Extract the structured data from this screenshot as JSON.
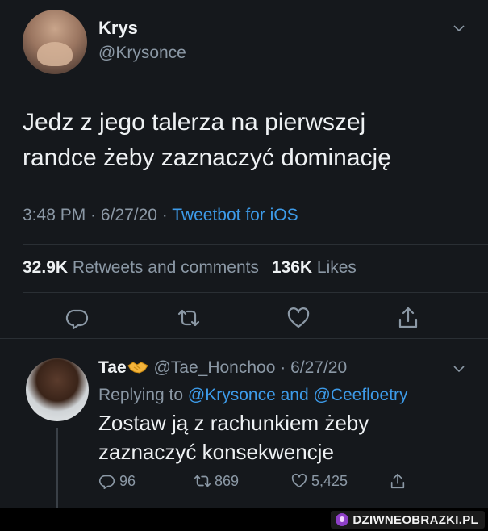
{
  "tweet": {
    "author_name": "Krys",
    "author_handle": "@Krysonce",
    "text_line1": "Jedz z jego talerza na pierwszej",
    "text_line2": "randce żeby zaznaczyć dominację",
    "time": "3:48 PM",
    "date": "6/27/20",
    "separator": " · ",
    "client": "Tweetbot for iOS",
    "retweets_count": "32.9K",
    "retweets_label": "Retweets and comments",
    "likes_count": "136K",
    "likes_label": "Likes",
    "icons": [
      "reply-icon",
      "retweet-icon",
      "like-icon",
      "share-icon"
    ]
  },
  "reply": {
    "author_name": "Tae",
    "author_emoji": "handshake-emoji",
    "author_handle": "@Tae_Honchoo",
    "date": "· 6/27/20",
    "replying_prefix": "Replying to",
    "mention1": "@Krysonce",
    "and": "and",
    "mention2": "@Ceefloetry",
    "text_line1": "Zostaw ją z rachunkiem żeby",
    "text_line2": "zaznaczyć konsekwencje",
    "replies": "96",
    "retweets": "869",
    "likes": "5,425"
  },
  "watermark": {
    "text": "DZIWNEOBRAZKI.PL",
    "accent": "#8e3fc7"
  },
  "colors": {
    "background": "#15181c",
    "link": "#3d9be9",
    "muted": "#8b98a5"
  }
}
